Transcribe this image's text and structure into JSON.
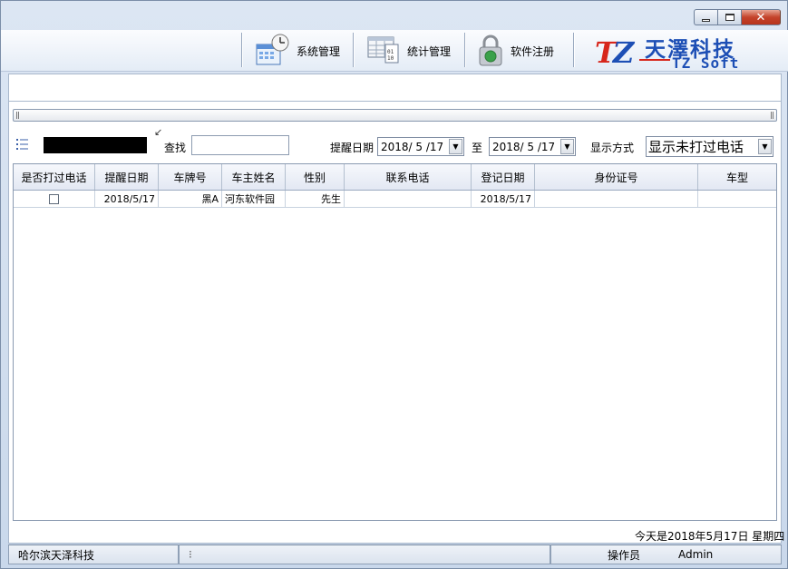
{
  "window": {
    "controls": {
      "minimize": "",
      "maximize": "",
      "close": "✕"
    }
  },
  "toolbar": {
    "items": [
      {
        "label": "系统管理",
        "icon": "calendar-clock-icon"
      },
      {
        "label": "统计管理",
        "icon": "spreadsheet-icon"
      },
      {
        "label": "软件注册",
        "icon": "padlock-icon"
      }
    ],
    "logo": {
      "mark_t": "T",
      "mark_z": "Z",
      "name_cn": "天澤科技",
      "name_en": "TZ Soft"
    }
  },
  "filter": {
    "search_label": "查找",
    "search_value": "",
    "remind_date_label": "提醒日期",
    "date_from": "2018/ 5 /17",
    "to_label": "至",
    "date_to": "2018/ 5 /17",
    "display_mode_label": "显示方式",
    "display_mode_value": "显示未打过电话"
  },
  "grid": {
    "columns": [
      "是否打过电话",
      "提醒日期",
      "车牌号",
      "车主姓名",
      "性别",
      "联系电话",
      "登记日期",
      "身份证号",
      "车型"
    ],
    "rows": [
      {
        "called": false,
        "remind_date": "2018/5/17",
        "plate": "黑A",
        "owner": "河东软件园",
        "gender": "先生",
        "phone": "",
        "register_date": "2018/5/17",
        "id_number": "",
        "car_type": ""
      }
    ]
  },
  "footer": {
    "today": "今天是2018年5月17日  星期四"
  },
  "status_bar": {
    "company": "哈尔滨天泽科技",
    "middle": "",
    "operator_label": "操作员",
    "operator_name": "Admin"
  }
}
